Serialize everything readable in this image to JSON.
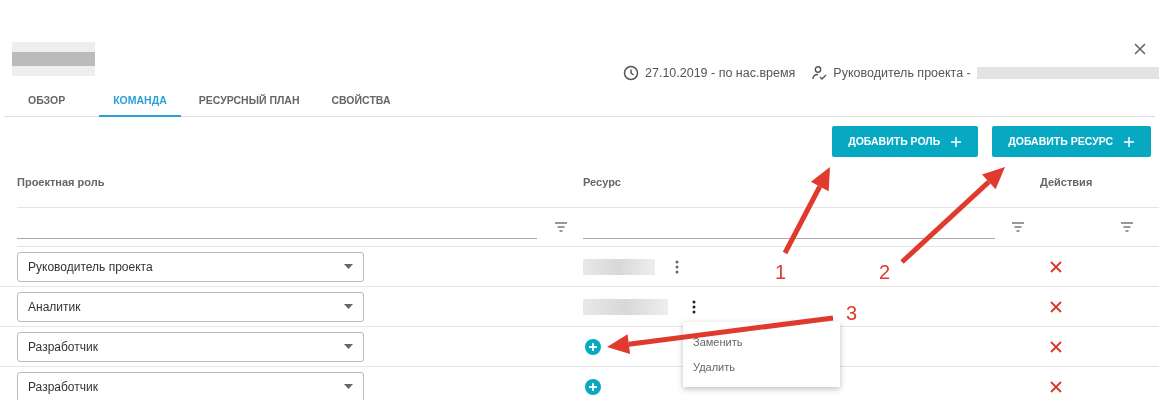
{
  "header": {
    "period": "27.10.2019 - по нас.время",
    "manager_label": "Руководитель проекта -"
  },
  "tabs": [
    {
      "label": "ОБЗОР",
      "selected": false
    },
    {
      "label": "КОМАНДА",
      "selected": true
    },
    {
      "label": "РЕСУРСНЫЙ ПЛАН",
      "selected": false
    },
    {
      "label": "СВОЙСТВА",
      "selected": false
    }
  ],
  "buttons": [
    {
      "label": "ДОБАВИТЬ РОЛЬ"
    },
    {
      "label": "ДОБАВИТЬ РЕСУРС"
    }
  ],
  "table": {
    "columns": [
      "Проектная роль",
      "Ресурс",
      "Действия"
    ],
    "rows": [
      {
        "role": "Руководитель проекта",
        "kind": "assigned",
        "menu_open": false
      },
      {
        "role": "Аналитик",
        "kind": "assigned",
        "menu_open": true
      },
      {
        "role": "Разработчик",
        "kind": "empty"
      },
      {
        "role": "Разработчик",
        "kind": "empty"
      }
    ]
  },
  "context_menu": [
    "Заменить",
    "Удалить"
  ],
  "annotations": [
    {
      "label": "1"
    },
    {
      "label": "2"
    },
    {
      "label": "3"
    }
  ]
}
